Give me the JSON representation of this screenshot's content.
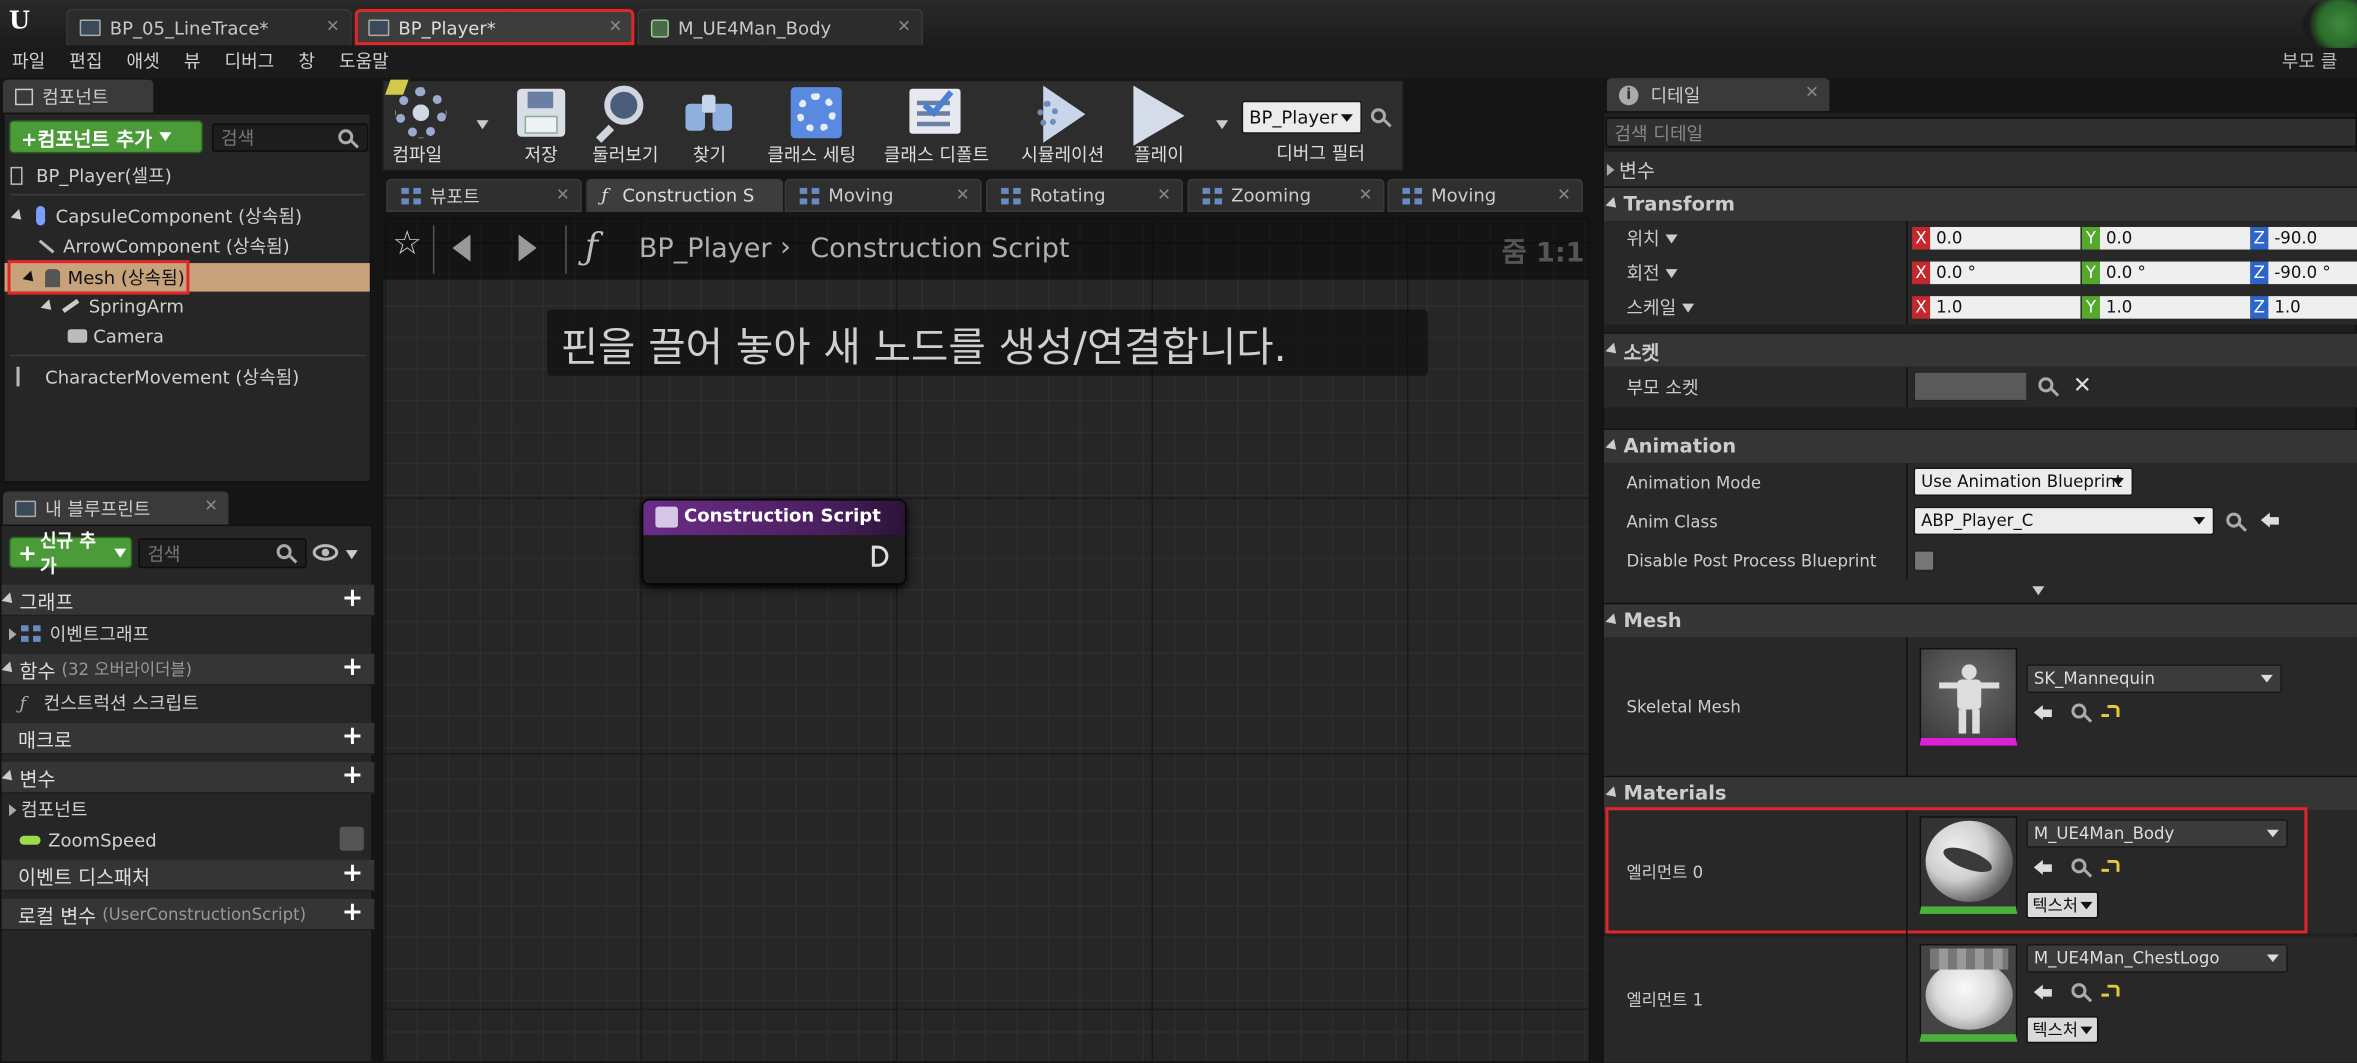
{
  "tabs": [
    {
      "label": "BP_05_LineTrace*"
    },
    {
      "label": "BP_Player*"
    },
    {
      "label": "M_UE4Man_Body"
    }
  ],
  "top_right_text": "부모 클",
  "menu": [
    "파일",
    "편집",
    "애셋",
    "뷰",
    "디버그",
    "창",
    "도움말"
  ],
  "components_panel": {
    "tab_label": "컴포넌트",
    "add_button": "+컴포넌트 추가",
    "search_placeholder": "검색",
    "root": "BP_Player(셀프)",
    "items": [
      "CapsuleComponent (상속됨)",
      "ArrowComponent (상속됨)",
      "Mesh (상속됨)",
      "SpringArm",
      "Camera",
      "CharacterMovement (상속됨)"
    ]
  },
  "toolbar": {
    "compile": "컴파일",
    "save": "저장",
    "browse": "둘러보기",
    "find": "찾기",
    "class_settings": "클래스 세팅",
    "class_defaults": "클래스 디폴트",
    "simulation": "시뮬레이션",
    "play": "플레이",
    "debug_combo": "BP_Player",
    "debug_filter": "디버그 필터"
  },
  "graph_tabs": [
    {
      "label": "뷰포트"
    },
    {
      "label": "Construction S"
    },
    {
      "label": "Moving"
    },
    {
      "label": "Rotating"
    },
    {
      "label": "Zooming"
    },
    {
      "label": "Moving"
    }
  ],
  "graph": {
    "breadcrumb_root": "BP_Player",
    "breadcrumb_leaf": "Construction Script",
    "zoom": "줌 1:1",
    "hint": "핀을 끌어 놓아 새 노드를 생성/연결합니다.",
    "node_title": "Construction Script"
  },
  "my_blueprint": {
    "tab_label": "내 블루프린트",
    "add_button": "신규 추가",
    "search_placeholder": "검색",
    "sections": {
      "graphs": "그래프",
      "event_graph": "이벤트그래프",
      "functions": "함수",
      "functions_note": "(32 오버라이더블)",
      "construction_script": "컨스트럭션 스크립트",
      "macros": "매크로",
      "variables": "변수",
      "components": "컴포넌트",
      "zoom_speed": "ZoomSpeed",
      "event_dispatchers": "이벤트 디스패처",
      "local_vars": "로컬 변수",
      "local_vars_note": "(UserConstructionScript)"
    }
  },
  "details": {
    "tab_label": "디테일",
    "search_placeholder": "검색 디테일",
    "variables": "변수",
    "transform": {
      "title": "Transform",
      "location_label": "위치",
      "rotation_label": "회전",
      "scale_label": "스케일",
      "axis_x": "X",
      "axis_y": "Y",
      "axis_z": "Z",
      "location": [
        "0.0",
        "0.0",
        "-90.0"
      ],
      "rotation": [
        "0.0 °",
        "0.0 °",
        "-90.0 °"
      ],
      "scale": [
        "1.0",
        "1.0",
        "1.0"
      ]
    },
    "socket": {
      "title": "소켓",
      "parent_socket": "부모 소켓"
    },
    "animation": {
      "title": "Animation",
      "mode_label": "Animation Mode",
      "mode_value": "Use Animation Blueprint",
      "class_label": "Anim Class",
      "class_value": "ABP_Player_C",
      "disable_label": "Disable Post Process Blueprint"
    },
    "mesh": {
      "title": "Mesh",
      "skeletal_label": "Skeletal Mesh",
      "skeletal_value": "SK_Mannequin"
    },
    "materials": {
      "title": "Materials",
      "elements": [
        {
          "label": "엘리먼트 0",
          "value": "M_UE4Man_Body",
          "tex": "텍스처"
        },
        {
          "label": "엘리먼트 1",
          "value": "M_UE4Man_ChestLogo",
          "tex": "텍스처"
        }
      ]
    }
  },
  "colors": {
    "accent_green": "#4b9c38",
    "highlight_red": "#e0262a",
    "node_purple": "#6b2d88",
    "selection_tan": "#c8a27a"
  }
}
